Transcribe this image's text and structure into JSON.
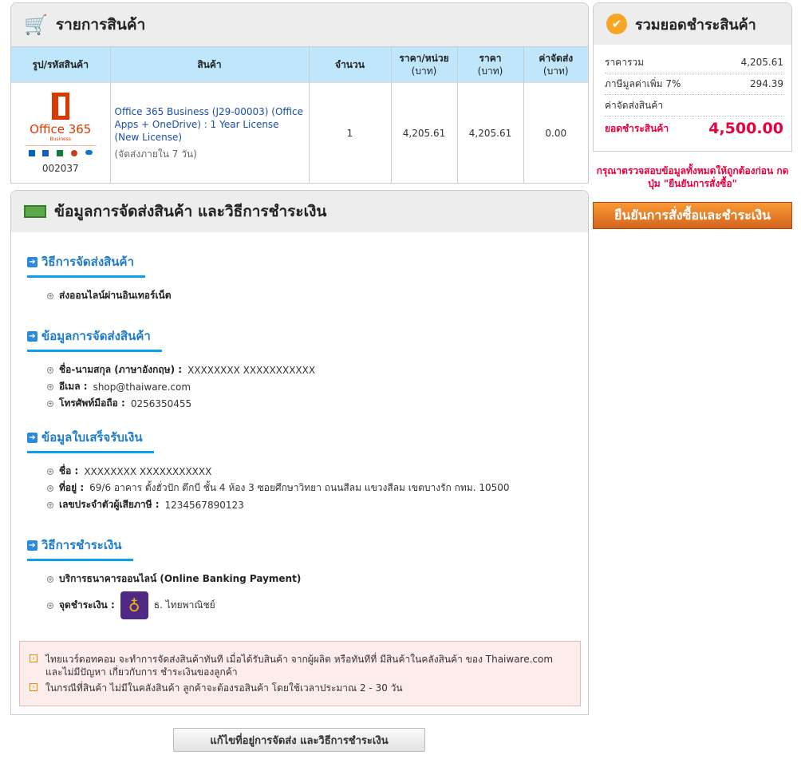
{
  "cart": {
    "title": "รายการสินค้า",
    "columns": [
      {
        "label": "รูป/รหัสสินค้า",
        "sub": ""
      },
      {
        "label": "สินค้า",
        "sub": ""
      },
      {
        "label": "จำนวน",
        "sub": ""
      },
      {
        "label": "ราคา/หน่วย",
        "sub": "(บาท)"
      },
      {
        "label": "ราคา",
        "sub": "(บาท)"
      },
      {
        "label": "ค่าจัดส่ง",
        "sub": "(บาท)"
      }
    ],
    "item": {
      "logo_text": "Office 365",
      "logo_sub": "Business",
      "code": "002037",
      "name": "Office 365 Business (J29-00003) (Office Apps + OneDrive) : 1 Year License (New License)",
      "delivery": "(จัดส่งภายใน 7 วัน)",
      "qty": "1",
      "unit_price": "4,205.61",
      "price": "4,205.61",
      "shipping": "0.00"
    }
  },
  "shipping": {
    "title": "ข้อมูลการจัดส่งสินค้า และวิธีการชำระเงิน",
    "method_title": "วิธีการจัดส่งสินค้า",
    "method": "ส่งออนไลน์ผ่านอินเทอร์เน็ต",
    "info_title": "ข้อมูลการจัดส่งสินค้า",
    "name_label": "ชื่อ-นามสกุล (ภาษาอังกฤษ) :",
    "name": "XXXXXXXX XXXXXXXXXXX",
    "email_label": "อีเมล :",
    "email": "shop@thaiware.com",
    "phone_label": "โทรศัพท์มือถือ :",
    "phone": "0256350455",
    "receipt_title": "ข้อมูลใบเสร็จรับเงิน",
    "r_name_label": "ชื่อ :",
    "r_name": "XXXXXXXX XXXXXXXXXXX",
    "r_addr_label": "ที่อยู่ :",
    "r_addr": "69/6 อาคาร ตั้งฮั่วปัก ตึกบี ชั้น 4 ห้อง 3 ซอยศึกษาวิทยา ถนนสีลม แขวงสีลม เขตบางรัก กทม. 10500",
    "r_tax_label": "เลขประจำตัวผู้เสียภาษี :",
    "r_tax": "1234567890123",
    "pay_title": "วิธีการชำระเงิน",
    "pay_method": "บริการธนาคารออนไลน์ (Online Banking Payment)",
    "pay_point_label": "จุดชำระเงิน :",
    "bank": "ธ. ไทยพาณิชย์",
    "notes": [
      "ไทยแวร์ดอทคอม จะทำการจัดส่งสินค้าทันที เมื่อได้รับสินค้า จากผู้ผลิต หรือทันทีที่ มีสินค้าในคลังสินค้า ของ Thaiware.com และไม่มีปัญหา เกี่ยวกับการ ชำระเงินของลูกค้า",
      "ในกรณีที่สินค้า ไม่มีในคลังสินค้า ลูกค้าจะต้องรอสินค้า โดยใช้เวลาประมาณ 2 - 30 วัน"
    ],
    "edit_button": "แก้ไขที่อยู่การจัดส่ง และวิธีการชำระเงิน"
  },
  "summary": {
    "title": "รวมยอดชำระสินค้า",
    "subtotal_label": "ราคารวม",
    "subtotal": "4,205.61",
    "vat_label": "ภาษีมูลค่าเพิ่ม 7%",
    "vat": "294.39",
    "ship_label": "ค่าจัดส่งสินค้า",
    "total_label": "ยอดชำระสินค้า",
    "total": "4,500.00",
    "warning": "กรุณาตรวจสอบข้อมูลทั้งหมดให้ถูกต้องก่อน กดปุ่ม \"ยืนยันการสั่งซื้อ\"",
    "confirm_button": "ยืนยันการสั่งซื้อและชำระเงิน"
  },
  "colors": {
    "accent": "#0aa0ef",
    "total": "#e8003d",
    "confirm": "#e57a22"
  }
}
